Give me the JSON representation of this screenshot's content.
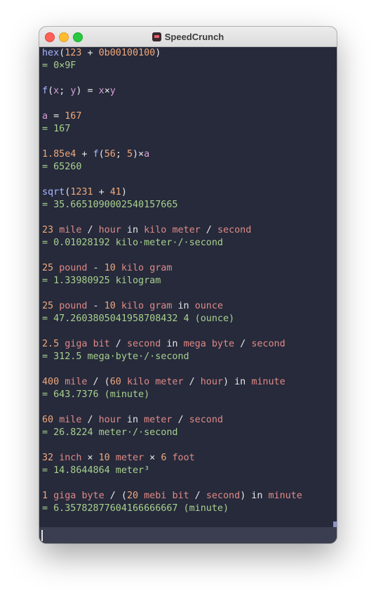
{
  "window": {
    "title": "SpeedCrunch"
  },
  "history": [
    {
      "expr": [
        {
          "t": "fn",
          "v": "hex"
        },
        {
          "t": "op",
          "v": "("
        },
        {
          "t": "num",
          "v": "123"
        },
        {
          "t": "op",
          "v": " + "
        },
        {
          "t": "num",
          "v": "0b00100100"
        },
        {
          "t": "op",
          "v": ")"
        }
      ],
      "result": "= 0×9F"
    },
    {
      "expr": [
        {
          "t": "fn",
          "v": "f"
        },
        {
          "t": "op",
          "v": "("
        },
        {
          "t": "var",
          "v": "x"
        },
        {
          "t": "op",
          "v": "; "
        },
        {
          "t": "var",
          "v": "y"
        },
        {
          "t": "op",
          "v": ") = "
        },
        {
          "t": "var",
          "v": "x"
        },
        {
          "t": "op",
          "v": "×"
        },
        {
          "t": "var",
          "v": "y"
        }
      ],
      "result": ""
    },
    {
      "expr": [
        {
          "t": "var",
          "v": "a"
        },
        {
          "t": "op",
          "v": " = "
        },
        {
          "t": "num",
          "v": "167"
        }
      ],
      "result": "= 167"
    },
    {
      "expr": [
        {
          "t": "num",
          "v": "1.85e4"
        },
        {
          "t": "op",
          "v": " + "
        },
        {
          "t": "fn",
          "v": "f"
        },
        {
          "t": "op",
          "v": "("
        },
        {
          "t": "num",
          "v": "56"
        },
        {
          "t": "op",
          "v": "; "
        },
        {
          "t": "num",
          "v": "5"
        },
        {
          "t": "op",
          "v": ")×"
        },
        {
          "t": "var",
          "v": "a"
        }
      ],
      "result": "= 65260"
    },
    {
      "expr": [
        {
          "t": "fn",
          "v": "sqrt"
        },
        {
          "t": "op",
          "v": "("
        },
        {
          "t": "num",
          "v": "1231"
        },
        {
          "t": "op",
          "v": " + "
        },
        {
          "t": "num",
          "v": "41"
        },
        {
          "t": "op",
          "v": ")"
        }
      ],
      "result": "= 35.6651090002540157665"
    },
    {
      "expr": [
        {
          "t": "num",
          "v": "23"
        },
        {
          "t": "op",
          "v": " "
        },
        {
          "t": "unit",
          "v": "mile"
        },
        {
          "t": "op",
          "v": " / "
        },
        {
          "t": "unit",
          "v": "hour"
        },
        {
          "t": "op",
          "v": " in "
        },
        {
          "t": "unit",
          "v": "kilo"
        },
        {
          "t": "op",
          "v": " "
        },
        {
          "t": "unit",
          "v": "meter"
        },
        {
          "t": "op",
          "v": " / "
        },
        {
          "t": "unit",
          "v": "second"
        }
      ],
      "result": "= 0.01028192 kilo·meter·/·second"
    },
    {
      "expr": [
        {
          "t": "num",
          "v": "25"
        },
        {
          "t": "op",
          "v": " "
        },
        {
          "t": "unit",
          "v": "pound"
        },
        {
          "t": "op",
          "v": " - "
        },
        {
          "t": "num",
          "v": "10"
        },
        {
          "t": "op",
          "v": " "
        },
        {
          "t": "unit",
          "v": "kilo"
        },
        {
          "t": "op",
          "v": " "
        },
        {
          "t": "unit",
          "v": "gram"
        }
      ],
      "result": "= 1.33980925 kilogram"
    },
    {
      "expr": [
        {
          "t": "num",
          "v": "25"
        },
        {
          "t": "op",
          "v": " "
        },
        {
          "t": "unit",
          "v": "pound"
        },
        {
          "t": "op",
          "v": " - "
        },
        {
          "t": "num",
          "v": "10"
        },
        {
          "t": "op",
          "v": " "
        },
        {
          "t": "unit",
          "v": "kilo"
        },
        {
          "t": "op",
          "v": " "
        },
        {
          "t": "unit",
          "v": "gram"
        },
        {
          "t": "op",
          "v": " in "
        },
        {
          "t": "unit",
          "v": "ounce"
        }
      ],
      "result": "= 47.2603805041958708432 4 (ounce)"
    },
    {
      "expr": [
        {
          "t": "num",
          "v": "2.5"
        },
        {
          "t": "op",
          "v": " "
        },
        {
          "t": "unit",
          "v": "giga"
        },
        {
          "t": "op",
          "v": " "
        },
        {
          "t": "unit",
          "v": "bit"
        },
        {
          "t": "op",
          "v": " / "
        },
        {
          "t": "unit",
          "v": "second"
        },
        {
          "t": "op",
          "v": " in "
        },
        {
          "t": "unit",
          "v": "mega"
        },
        {
          "t": "op",
          "v": " "
        },
        {
          "t": "unit",
          "v": "byte"
        },
        {
          "t": "op",
          "v": " / "
        },
        {
          "t": "unit",
          "v": "second"
        }
      ],
      "result": "= 312.5 mega·byte·/·second"
    },
    {
      "expr": [
        {
          "t": "num",
          "v": "400"
        },
        {
          "t": "op",
          "v": " "
        },
        {
          "t": "unit",
          "v": "mile"
        },
        {
          "t": "op",
          "v": " / ("
        },
        {
          "t": "num",
          "v": "60"
        },
        {
          "t": "op",
          "v": " "
        },
        {
          "t": "unit",
          "v": "kilo"
        },
        {
          "t": "op",
          "v": " "
        },
        {
          "t": "unit",
          "v": "meter"
        },
        {
          "t": "op",
          "v": " / "
        },
        {
          "t": "unit",
          "v": "hour"
        },
        {
          "t": "op",
          "v": ") in "
        },
        {
          "t": "unit",
          "v": "minute"
        }
      ],
      "result": "= 643.7376 (minute)"
    },
    {
      "expr": [
        {
          "t": "num",
          "v": "60"
        },
        {
          "t": "op",
          "v": " "
        },
        {
          "t": "unit",
          "v": "mile"
        },
        {
          "t": "op",
          "v": " / "
        },
        {
          "t": "unit",
          "v": "hour"
        },
        {
          "t": "op",
          "v": " in "
        },
        {
          "t": "unit",
          "v": "meter"
        },
        {
          "t": "op",
          "v": " / "
        },
        {
          "t": "unit",
          "v": "second"
        }
      ],
      "result": "= 26.8224 meter·/·second"
    },
    {
      "expr": [
        {
          "t": "num",
          "v": "32"
        },
        {
          "t": "op",
          "v": " "
        },
        {
          "t": "unit",
          "v": "inch"
        },
        {
          "t": "op",
          "v": " × "
        },
        {
          "t": "num",
          "v": "10"
        },
        {
          "t": "op",
          "v": " "
        },
        {
          "t": "unit",
          "v": "meter"
        },
        {
          "t": "op",
          "v": " × "
        },
        {
          "t": "num",
          "v": "6"
        },
        {
          "t": "op",
          "v": " "
        },
        {
          "t": "unit",
          "v": "foot"
        }
      ],
      "result": "= 14.8644864 meter³"
    },
    {
      "expr": [
        {
          "t": "num",
          "v": "1"
        },
        {
          "t": "op",
          "v": " "
        },
        {
          "t": "unit",
          "v": "giga"
        },
        {
          "t": "op",
          "v": " "
        },
        {
          "t": "unit",
          "v": "byte"
        },
        {
          "t": "op",
          "v": " / ("
        },
        {
          "t": "num",
          "v": "20"
        },
        {
          "t": "op",
          "v": " "
        },
        {
          "t": "unit",
          "v": "mebi"
        },
        {
          "t": "op",
          "v": " "
        },
        {
          "t": "unit",
          "v": "bit"
        },
        {
          "t": "op",
          "v": " / "
        },
        {
          "t": "unit",
          "v": "second"
        },
        {
          "t": "op",
          "v": ") in "
        },
        {
          "t": "unit",
          "v": "minute"
        }
      ],
      "result": "= 6.35782877604166666667 (minute)"
    }
  ],
  "input": {
    "value": ""
  },
  "colors": {
    "background": "#262a3b",
    "function": "#a9b6ff",
    "number": "#f0a87a",
    "operator": "#e6e6e6",
    "variable": "#d79fd6",
    "unit": "#e08a86",
    "result": "#a8d18d"
  }
}
